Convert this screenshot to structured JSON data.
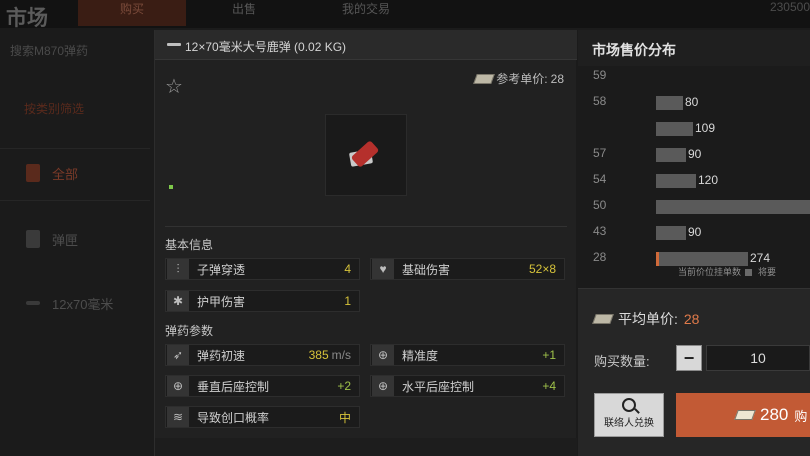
{
  "background": {
    "title": "市场",
    "tabs": [
      "购买",
      "出售",
      "我的交易"
    ],
    "balance": "230500",
    "search_text": "搜索M870弹药",
    "filter_label": "按类别筛选",
    "categories": [
      {
        "label": "全部",
        "active": true
      },
      {
        "label": "弹匣",
        "active": false
      },
      {
        "label": "12x70毫米",
        "active": false
      }
    ]
  },
  "item": {
    "title": "12×70毫米大号鹿弹 (0.02 KG)",
    "ref_price_label": "参考单价:",
    "ref_price": "28",
    "basic_info_title": "基本信息",
    "ammo_params_title": "弹药参数",
    "stats": [
      {
        "label": "子弹穿透",
        "value": "4",
        "unit": "",
        "icon": "penetration-icon"
      },
      {
        "label": "基础伤害",
        "value": "52×8",
        "unit": "",
        "icon": "broken-heart-icon"
      },
      {
        "label": "护甲伤害",
        "value": "1",
        "unit": "",
        "icon": "armor-damage-icon"
      },
      {
        "label": "弹药初速",
        "value": "385",
        "unit": "m/s",
        "icon": "velocity-icon"
      },
      {
        "label": "精准度",
        "value": "+1",
        "unit": "",
        "icon": "crosshair-icon"
      },
      {
        "label": "垂直后座控制",
        "value": "+2",
        "unit": "",
        "icon": "vertical-recoil-icon"
      },
      {
        "label": "水平后座控制",
        "value": "+4",
        "unit": "",
        "icon": "horizontal-recoil-icon"
      },
      {
        "label": "导致创口概率",
        "value": "中",
        "unit": "",
        "icon": "wound-icon"
      }
    ]
  },
  "market": {
    "title": "市场售价分布",
    "legend_current": "当前价位挂单数",
    "legend_other": "将要",
    "avg_label": "平均单价:",
    "avg_value": "28",
    "qty_label": "购买数量:",
    "qty_value": "10",
    "contact_label": "联络人兑换",
    "buy_value": "280",
    "buy_suffix": "购"
  },
  "chart_data": {
    "type": "bar",
    "orientation": "horizontal",
    "categories": [
      "59",
      "58",
      "57",
      "54",
      "50",
      "43",
      "28"
    ],
    "values": [
      null,
      80,
      109,
      90,
      120,
      null,
      90,
      274
    ],
    "rows": [
      {
        "price": "59",
        "count": null
      },
      {
        "price": "58",
        "count": 80
      },
      {
        "price": "",
        "count": 109
      },
      {
        "price": "57",
        "count": 90
      },
      {
        "price": "54",
        "count": 120
      },
      {
        "price": "50",
        "count": null,
        "note": "bar extends past visible area"
      },
      {
        "price": "43",
        "count": 90
      },
      {
        "price": "28",
        "count": 274,
        "current": true
      }
    ],
    "title": "市场售价分布"
  }
}
